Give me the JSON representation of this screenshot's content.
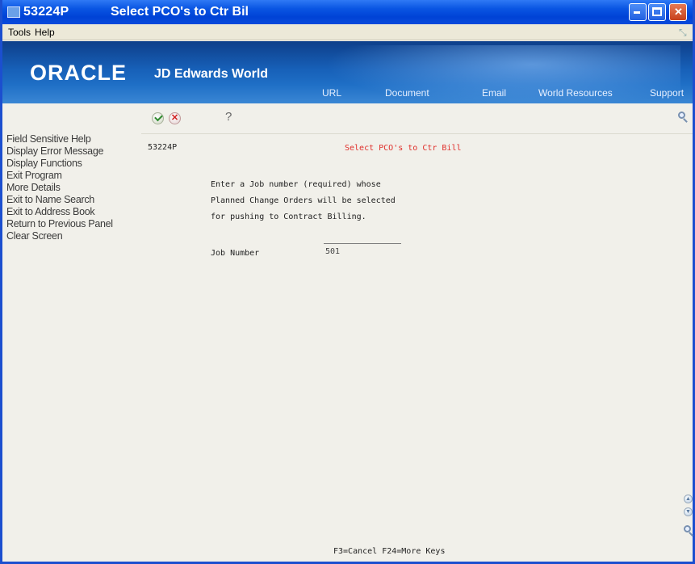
{
  "window": {
    "app_id": "53224P",
    "title": "Select PCO's to Ctr Bil"
  },
  "menu": {
    "tools": "Tools",
    "help": "Help"
  },
  "banner": {
    "brand": "ORACLE",
    "product": "JD Edwards World",
    "links": [
      "URL",
      "Document",
      "Email",
      "World Resources",
      "Support"
    ]
  },
  "sidebar": {
    "items": [
      "Field Sensitive Help",
      "Display Error Message",
      "Display Functions",
      "Exit Program",
      "More Details",
      "Exit to Name Search",
      "Exit to Address Book",
      "Return to Previous Panel",
      "Clear Screen"
    ]
  },
  "toolbar": {
    "help_glyph": "?"
  },
  "form": {
    "program_id": "53224P",
    "title": "Select PCO's to Ctr Bill",
    "instructions": [
      "Enter a Job number (required) whose",
      "Planned Change Orders will be selected",
      "for pushing to Contract Billing."
    ],
    "job_number_label": "Job Number",
    "job_number_value": "501",
    "function_keys": "F3=Cancel   F24=More Keys"
  },
  "colors": {
    "title_bar": "#0042d6",
    "banner": "#1760b8",
    "form_title": "#e0302c"
  }
}
